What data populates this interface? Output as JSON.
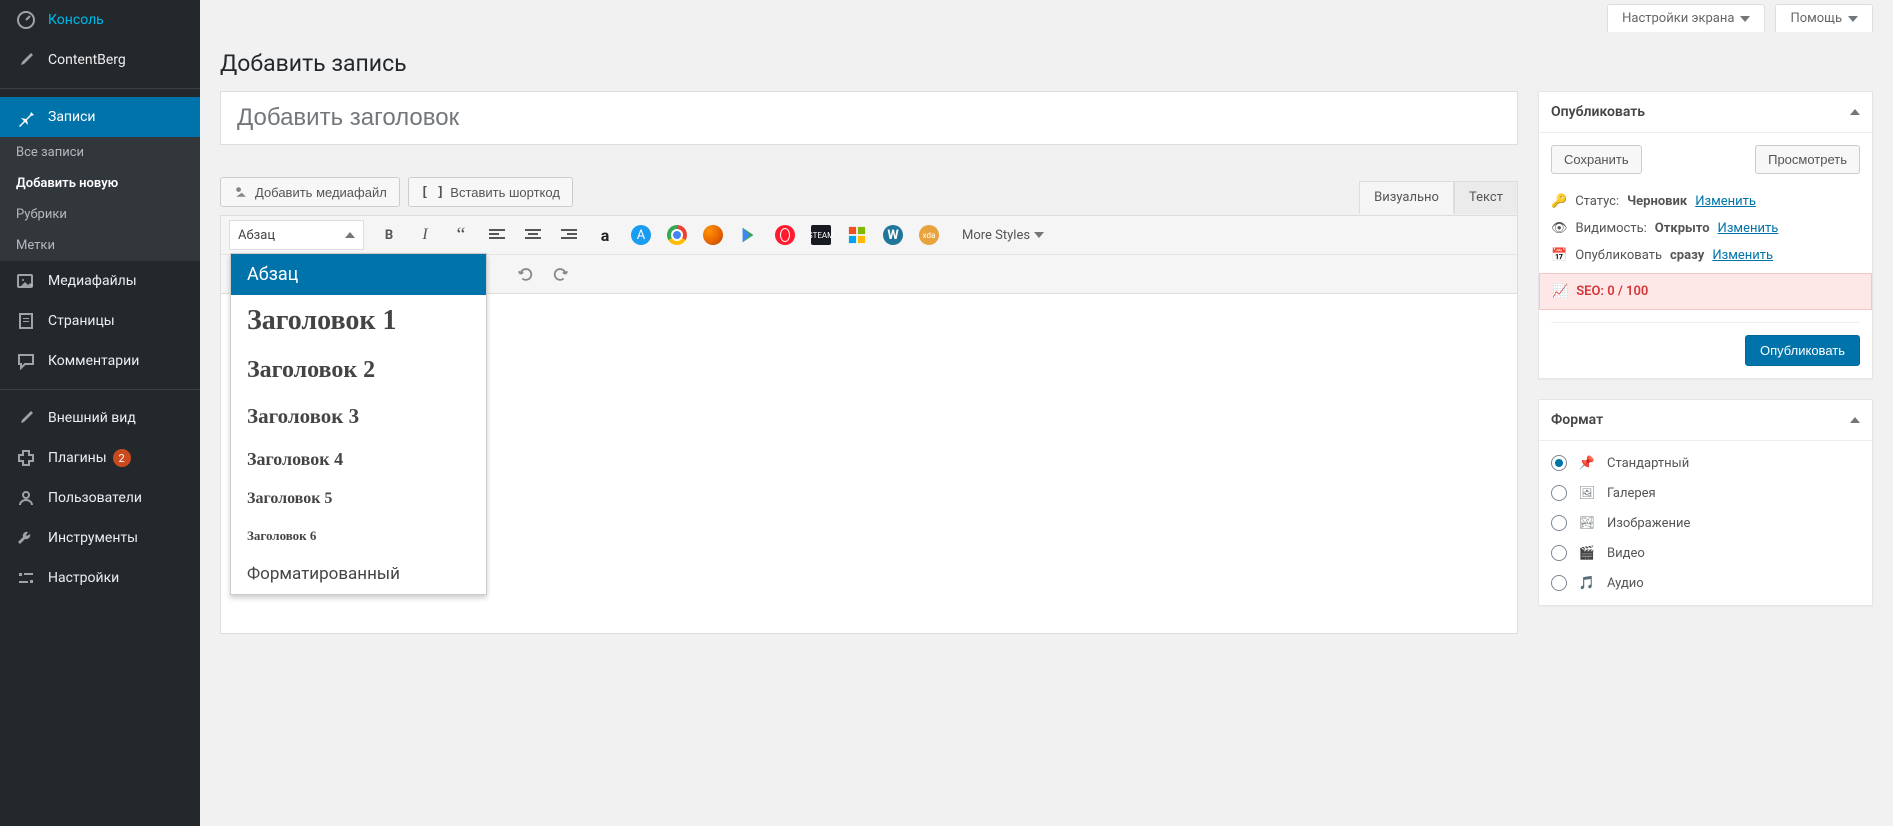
{
  "topTabs": {
    "screenOptions": "Настройки экрана",
    "help": "Помощь"
  },
  "pageTitle": "Добавить запись",
  "sidebar": {
    "items": [
      {
        "label": "Консоль"
      },
      {
        "label": "ContentBerg"
      },
      {
        "label": "Записи"
      },
      {
        "label": "Медиафайлы"
      },
      {
        "label": "Страницы"
      },
      {
        "label": "Комментарии"
      },
      {
        "label": "Внешний вид"
      },
      {
        "label": "Плагины",
        "badge": "2"
      },
      {
        "label": "Пользователи"
      },
      {
        "label": "Инструменты"
      },
      {
        "label": "Настройки"
      }
    ],
    "submenu": [
      {
        "label": "Все записи"
      },
      {
        "label": "Добавить новую"
      },
      {
        "label": "Рубрики"
      },
      {
        "label": "Метки"
      }
    ]
  },
  "editor": {
    "titlePlaceholder": "Добавить заголовок",
    "addMedia": "Добавить медиафайл",
    "insertShortcode": "Вставить шорткод",
    "tabVisual": "Визуально",
    "tabText": "Текст",
    "formatSelected": "Абзац",
    "moreStyles": "More Styles",
    "formatOptions": {
      "p": "Абзац",
      "h1": "Заголовок 1",
      "h2": "Заголовок 2",
      "h3": "Заголовок 3",
      "h4": "Заголовок 4",
      "h5": "Заголовок 5",
      "h6": "Заголовок 6",
      "pre": "Форматированный"
    }
  },
  "publish": {
    "title": "Опубликовать",
    "saveDraft": "Сохранить",
    "preview": "Просмотреть",
    "statusLabel": "Статус:",
    "statusValue": "Черновик",
    "visibilityLabel": "Видимость:",
    "visibilityValue": "Открыто",
    "scheduleLabel": "Опубликовать",
    "scheduleValue": "сразу",
    "editLink": "Изменить",
    "seo": "SEO: 0 / 100",
    "publishBtn": "Опубликовать"
  },
  "format": {
    "title": "Формат",
    "options": [
      {
        "label": "Стандартный",
        "checked": true
      },
      {
        "label": "Галерея"
      },
      {
        "label": "Изображение"
      },
      {
        "label": "Видео"
      },
      {
        "label": "Аудио"
      }
    ]
  }
}
